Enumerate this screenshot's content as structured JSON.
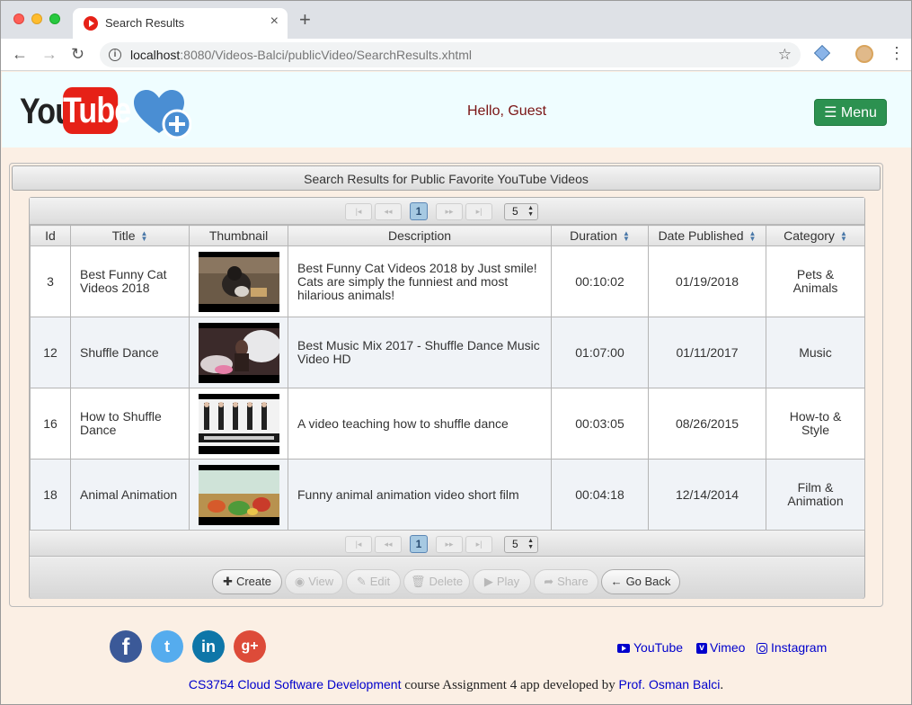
{
  "browser": {
    "tab_title": "Search Results",
    "tab_close": "×",
    "new_tab": "+",
    "url_host": "localhost",
    "url_rest": ":8080/Videos-Balci/publicVideo/SearchResults.xhtml"
  },
  "header": {
    "logo_you": "You",
    "logo_tube": "Tube",
    "greeting": "Hello, Guest",
    "menu_label": "☰ Menu"
  },
  "panel": {
    "title": "Search Results for Public Favorite YouTube Videos"
  },
  "paginator": {
    "first": "|◂",
    "prev": "◂◂",
    "current_page": "1",
    "next": "▸▸",
    "last": "▸|",
    "rows_per_page": "5"
  },
  "table": {
    "columns": [
      "Id",
      "Title",
      "Thumbnail",
      "Description",
      "Duration",
      "Date Published",
      "Category"
    ],
    "rows": [
      {
        "id": "3",
        "title": "Best Funny Cat Videos 2018",
        "description": "Best Funny Cat Videos 2018 by Just smile! Cats are simply the funniest and most hilarious animals!",
        "duration": "00:10:02",
        "date": "01/19/2018",
        "category": "Pets & Animals"
      },
      {
        "id": "12",
        "title": "Shuffle Dance",
        "description": "Best Music Mix 2017 - Shuffle Dance Music Video HD",
        "duration": "01:07:00",
        "date": "01/11/2017",
        "category": "Music"
      },
      {
        "id": "16",
        "title": "How to Shuffle Dance",
        "description": "A video teaching how to shuffle dance",
        "duration": "00:03:05",
        "date": "08/26/2015",
        "category": "How-to & Style"
      },
      {
        "id": "18",
        "title": "Animal Animation",
        "description": "Funny animal animation video short film",
        "duration": "00:04:18",
        "date": "12/14/2014",
        "category": "Film & Animation"
      }
    ]
  },
  "actions": {
    "create": "Create",
    "view": "View",
    "edit": "Edit",
    "delete": "Delete",
    "play": "Play",
    "share": "Share",
    "go_back": "Go Back"
  },
  "footer": {
    "facebook": "f",
    "twitter": "t",
    "linkedin": "in",
    "googleplus": "g+",
    "youtube_link": "YouTube",
    "vimeo_link": "Vimeo",
    "instagram_link": "Instagram",
    "course_link": "CS3754 Cloud Software Development",
    "credit_text": " course Assignment 4 app developed by ",
    "author_link": "Prof. Osman Balci",
    "period": "."
  }
}
